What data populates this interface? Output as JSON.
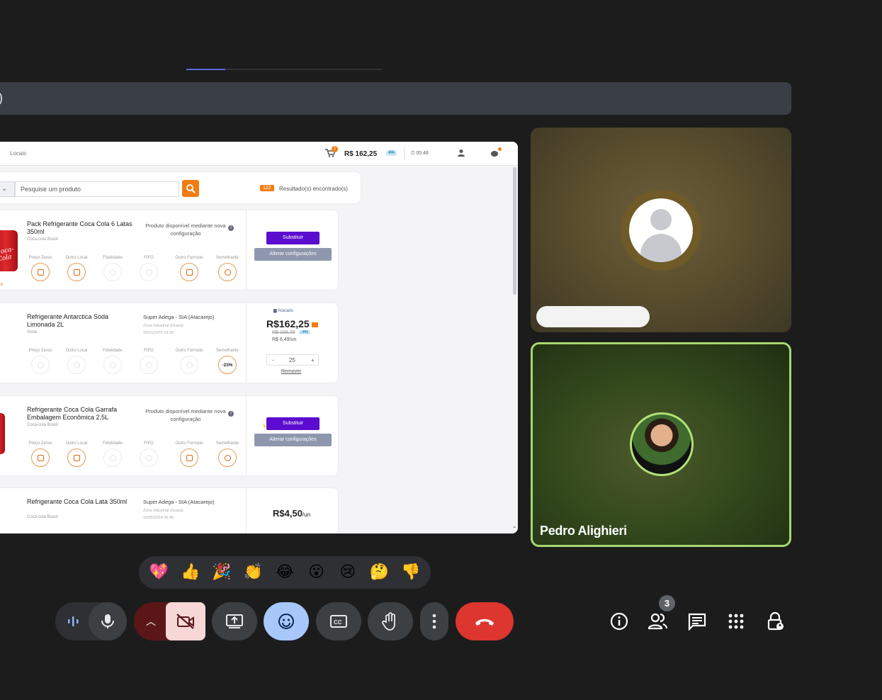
{
  "banner": {
    "text": ")"
  },
  "progress": {
    "fraction": 0.2
  },
  "shared_screen": {
    "breadcrumb": "Locais",
    "cart_count": "1",
    "total": "R$ 162,25",
    "total_discount": "4%",
    "timer": "05:48",
    "search": {
      "placeholder": "Pesquise um produto"
    },
    "results_count": "122",
    "results_label": "Resultado(s) encontrado(s)",
    "option_labels": [
      "Preço Zeroo",
      "Outro Local",
      "Fidelidade",
      "FIFO",
      "Outro Formato",
      "Semelhante"
    ],
    "products": [
      {
        "name": "Pack Refrigerante Coca Cola 6 Latas 350ml",
        "brand": "Coca-cola Brasil",
        "note": "Produto disponível mediante nova configuração",
        "substitute_label": "Substituir",
        "alter_label": "Alterar configurações",
        "side_tag": "lo"
      },
      {
        "name": "Refrigerante Antarctica Soda Limonada 2L",
        "brand": "Soda",
        "store": "Super Adega - SIA (Atacarejo)",
        "store_zone": "Zona Industrial (Guará)",
        "store_date": "20/01/1970 19:28",
        "tag": "Atacado",
        "price": "R$162,25",
        "old_price": "R$ 169,75",
        "discount": "-4%",
        "unit_price": "R$ 6,49/un",
        "similar_pct": "-23%",
        "quantity": "25",
        "minus": "-",
        "plus": "+",
        "remove_label": "Remover"
      },
      {
        "name": "Refrigerante Coca Cola Garrafa Embalagem Econômica 2,5L",
        "brand": "Coca-cola Brasil",
        "note": "Produto disponível mediante nova configuração",
        "substitute_label": "Substituir",
        "alter_label": "Alterar configurações"
      },
      {
        "name": "Refrigerante Coca Cola Lata 350ml",
        "brand": "Coca-cola Brasil",
        "store": "Super Adega - SIA (Atacarejo)",
        "store_zone": "Zona Industrial (Guará)",
        "store_date": "19/05/2024 06:48",
        "price": "R$4,50",
        "price_unit": "/un"
      }
    ]
  },
  "participants": [
    {
      "name": ""
    },
    {
      "name": "Pedro Alighieri"
    }
  ],
  "reactions": [
    "💖",
    "👍",
    "🎉",
    "👏",
    "😂",
    "😮",
    "😢",
    "🤔",
    "👎"
  ],
  "controls": {
    "people_count": "3",
    "colors": {
      "leave": "#dc362e",
      "emoji_active": "#a8c7fa",
      "camera_off": "#f7d8d6",
      "speaker_border": "#a8d672"
    }
  }
}
